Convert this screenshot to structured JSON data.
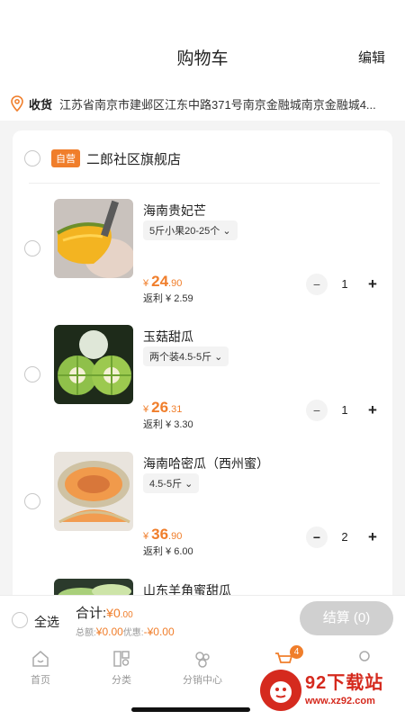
{
  "header": {
    "title": "购物车",
    "edit_label": "编辑"
  },
  "address": {
    "label": "收货",
    "text": "江苏省南京市建邺区江东中路371号南京金融城南京金融城4..."
  },
  "store": {
    "badge": "自营",
    "name": "二郎社区旗舰店"
  },
  "items": [
    {
      "name": "海南贵妃芒",
      "spec": "5斤小果20-25个",
      "price_currency": "¥",
      "price_int": "24",
      "price_dec": ".90",
      "rebate": "返利 ¥ 2.59",
      "qty": "1"
    },
    {
      "name": "玉菇甜瓜",
      "spec": "两个装4.5-5斤",
      "price_currency": "¥",
      "price_int": "26",
      "price_dec": ".31",
      "rebate": "返利 ¥ 3.30",
      "qty": "1"
    },
    {
      "name": "海南哈密瓜（西州蜜）",
      "spec": "4.5-5斤",
      "price_currency": "¥",
      "price_int": "36",
      "price_dec": ".90",
      "rebate": "返利 ¥ 6.00",
      "qty": "2"
    },
    {
      "name": "山东羊角蜜甜瓜"
    }
  ],
  "checkout": {
    "select_all": "全选",
    "total_label": "合计:",
    "total_currency": "¥",
    "total_int": "0",
    "total_dec": ".00",
    "sum_label": "总额:",
    "sum_value": "¥0.00",
    "discount_label": "优惠:",
    "discount_value": "-¥0.00",
    "pay_label": "结算 (0)"
  },
  "tabbar": {
    "items": [
      {
        "label": "首页",
        "icon": "home-icon"
      },
      {
        "label": "分类",
        "icon": "category-icon"
      },
      {
        "label": "分销中心",
        "icon": "distribution-icon"
      },
      {
        "label": "",
        "icon": "cart-icon"
      },
      {
        "label": "",
        "icon": "profile-icon"
      }
    ],
    "cart_badge": "4"
  },
  "watermark": {
    "title": "92下载站",
    "url": "www.xz92.com"
  },
  "colors": {
    "accent": "#f07e2b",
    "disabled_button": "#d0d0d0",
    "background": "#f4f4f4"
  }
}
